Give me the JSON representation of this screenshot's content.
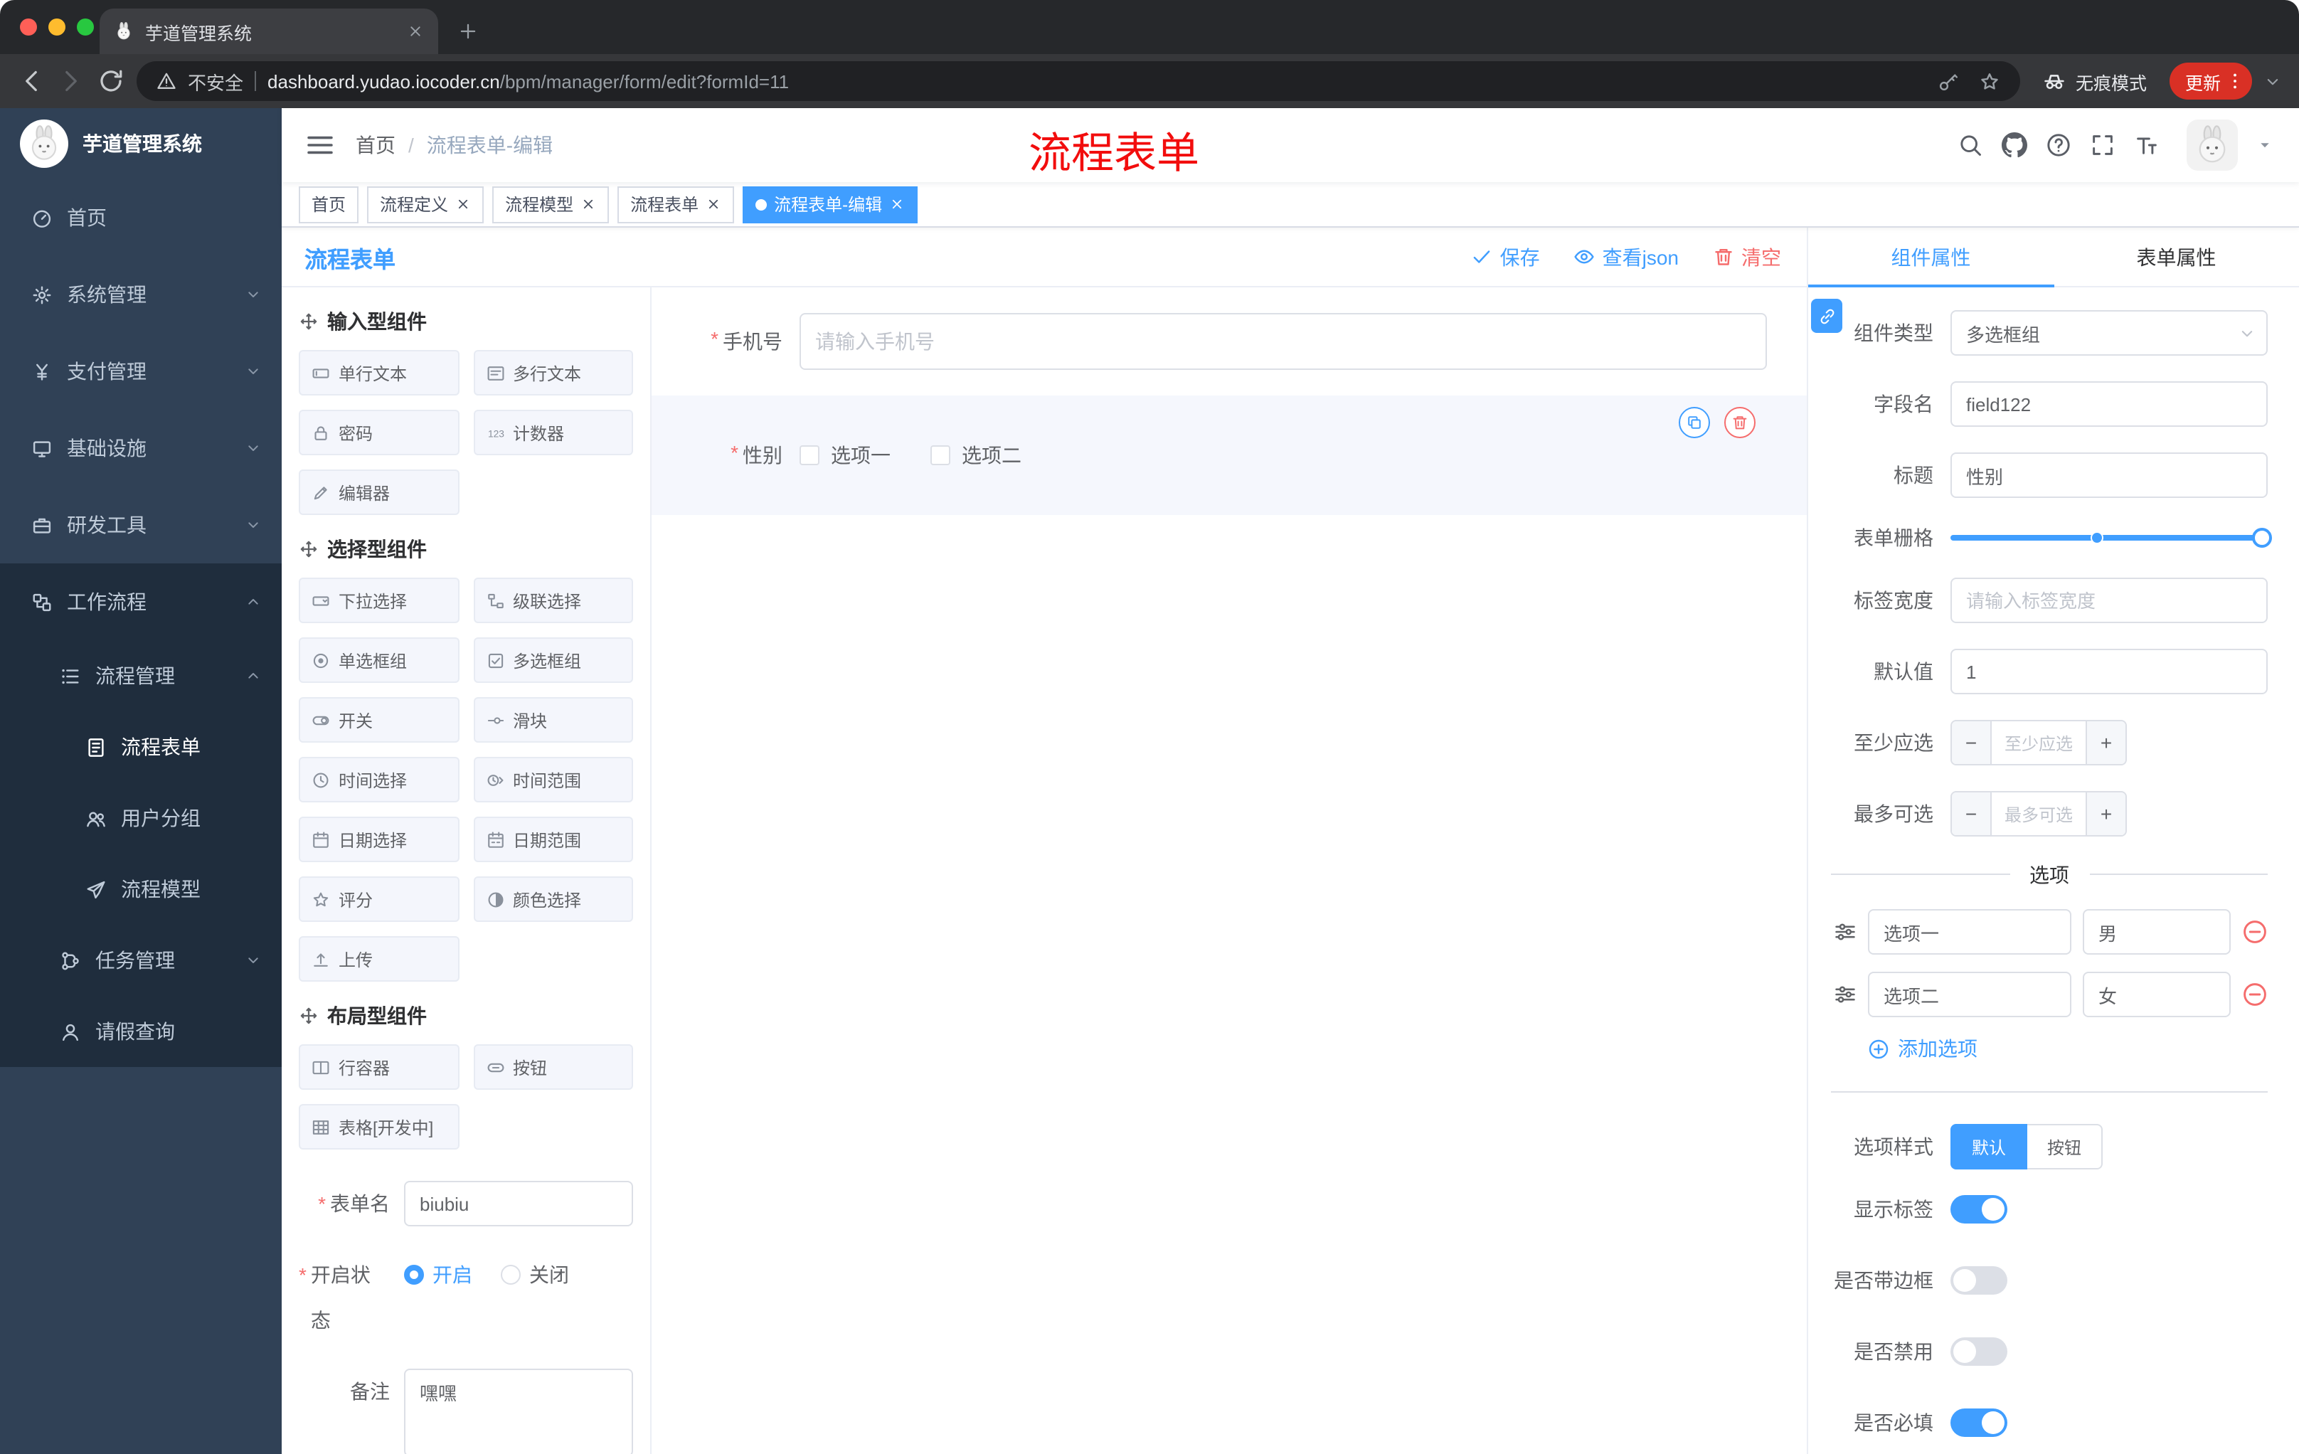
{
  "colors": {
    "primary": "#409eff",
    "danger": "#f56c6c",
    "annotation": "#f20d0d",
    "sidebar_bg": "#304156",
    "sidebar_submenu_bg": "#1f2d3d",
    "update_pill": "#d93025"
  },
  "browser": {
    "tab_title": "芋道管理系统",
    "security_label": "不安全",
    "url_domain": "dashboard.yudao.iocoder.cn",
    "url_path": "/bpm/manager/form/edit?formId=11",
    "incognito_label": "无痕模式",
    "update_label": "更新"
  },
  "sidebar": {
    "logo_title": "芋道管理系统",
    "menu": [
      {
        "name": "home",
        "label": "首页",
        "icon": "dashboard-icon",
        "level": 1
      },
      {
        "name": "system-manage",
        "label": "系统管理",
        "icon": "gear-icon",
        "level": 1,
        "chevron": "down"
      },
      {
        "name": "payment-manage",
        "label": "支付管理",
        "icon": "payment-icon",
        "level": 1,
        "chevron": "down"
      },
      {
        "name": "infrastructure",
        "label": "基础设施",
        "icon": "infrastructure-icon",
        "level": 1,
        "chevron": "down"
      },
      {
        "name": "dev-tools",
        "label": "研发工具",
        "icon": "devtools-icon",
        "level": 1,
        "chevron": "down"
      },
      {
        "name": "workflow",
        "label": "工作流程",
        "icon": "workflow-icon",
        "level": 1,
        "chevron": "up",
        "dark": true
      },
      {
        "name": "process-manage",
        "label": "流程管理",
        "icon": "process-manage-icon",
        "level": 2,
        "chevron": "up",
        "dark": true
      },
      {
        "name": "process-form",
        "label": "流程表单",
        "icon": "form-icon",
        "level": 3,
        "dark": true,
        "active": true
      },
      {
        "name": "user-group",
        "label": "用户分组",
        "icon": "user-group-icon",
        "level": 3,
        "dark": true
      },
      {
        "name": "process-model",
        "label": "流程模型",
        "icon": "model-icon",
        "level": 3,
        "dark": true
      },
      {
        "name": "task-manage",
        "label": "任务管理",
        "icon": "task-icon",
        "level": 2,
        "chevron": "down",
        "dark": true
      },
      {
        "name": "leave-query",
        "label": "请假查询",
        "icon": "leave-icon",
        "level": 2,
        "dark": true
      }
    ]
  },
  "header": {
    "breadcrumb": [
      "首页",
      "流程表单-编辑"
    ],
    "annotation": "流程表单"
  },
  "tags": [
    {
      "name": "home",
      "label": "首页"
    },
    {
      "name": "process-definition",
      "label": "流程定义",
      "closable": true
    },
    {
      "name": "process-model",
      "label": "流程模型",
      "closable": true
    },
    {
      "name": "process-form",
      "label": "流程表单",
      "closable": true
    },
    {
      "name": "process-form-edit",
      "label": "流程表单-编辑",
      "closable": true,
      "active": true
    }
  ],
  "designer": {
    "title": "流程表单",
    "actions": [
      {
        "label": "保存",
        "icon": "check-icon",
        "type": "primary"
      },
      {
        "label": "查看json",
        "icon": "eye-icon",
        "type": "primary"
      },
      {
        "label": "清空",
        "icon": "trash-icon",
        "type": "danger"
      }
    ],
    "palette_groups": [
      {
        "title": "输入型组件",
        "items": [
          {
            "name": "single-line-text",
            "label": "单行文本",
            "icon": "single-line-icon"
          },
          {
            "name": "multi-line-text",
            "label": "多行文本",
            "icon": "multi-line-icon"
          },
          {
            "name": "password",
            "label": "密码",
            "icon": "password-icon"
          },
          {
            "name": "counter",
            "label": "计数器",
            "icon": "counter-icon"
          },
          {
            "name": "editor",
            "label": "编辑器",
            "icon": "editor-icon"
          }
        ]
      },
      {
        "title": "选择型组件",
        "items": [
          {
            "name": "select",
            "label": "下拉选择",
            "icon": "select-icon"
          },
          {
            "name": "cascader",
            "label": "级联选择",
            "icon": "cascader-icon"
          },
          {
            "name": "radio-group",
            "label": "单选框组",
            "icon": "radio-icon"
          },
          {
            "name": "checkbox-group",
            "label": "多选框组",
            "icon": "checkbox-icon"
          },
          {
            "name": "switch",
            "label": "开关",
            "icon": "switch-icon"
          },
          {
            "name": "slider",
            "label": "滑块",
            "icon": "slider-icon"
          },
          {
            "name": "time-picker",
            "label": "时间选择",
            "icon": "time-icon"
          },
          {
            "name": "time-range",
            "label": "时间范围",
            "icon": "time-range-icon"
          },
          {
            "name": "date-picker",
            "label": "日期选择",
            "icon": "date-icon"
          },
          {
            "name": "date-range",
            "label": "日期范围",
            "icon": "date-range-icon"
          },
          {
            "name": "rate",
            "label": "评分",
            "icon": "rate-icon"
          },
          {
            "name": "color-picker",
            "label": "颜色选择",
            "icon": "color-icon"
          },
          {
            "name": "upload",
            "label": "上传",
            "icon": "upload-icon"
          }
        ]
      },
      {
        "title": "布局型组件",
        "items": [
          {
            "name": "row-container",
            "label": "行容器",
            "icon": "row-icon"
          },
          {
            "name": "button",
            "label": "按钮",
            "icon": "button-icon"
          },
          {
            "name": "table",
            "label": "表格[开发中]",
            "icon": "table-icon"
          }
        ]
      }
    ],
    "meta": {
      "form_name_label": "表单名",
      "form_name_value": "biubiu",
      "status_label": "开启状态",
      "status_on": "开启",
      "status_off": "关闭",
      "remark_label": "备注",
      "remark_value": "嘿嘿"
    },
    "canvas": {
      "phone": {
        "label": "手机号",
        "placeholder": "请输入手机号"
      },
      "gender": {
        "label": "性别",
        "options": [
          "选项一",
          "选项二"
        ]
      }
    }
  },
  "properties": {
    "tabs": [
      "组件属性",
      "表单属性"
    ],
    "active_tab": "组件属性",
    "component_type": {
      "label": "组件类型",
      "value": "多选框组"
    },
    "field_name": {
      "label": "字段名",
      "value": "field122"
    },
    "title": {
      "label": "标题",
      "value": "性别"
    },
    "grid": {
      "label": "表单栅格"
    },
    "label_width": {
      "label": "标签宽度",
      "placeholder": "请输入标签宽度"
    },
    "default_value": {
      "label": "默认值",
      "value": "1"
    },
    "min_select": {
      "label": "至少应选",
      "placeholder": "至少应选"
    },
    "max_select": {
      "label": "最多可选",
      "placeholder": "最多可选"
    },
    "options_title": "选项",
    "options": [
      {
        "label": "选项一",
        "value": "男"
      },
      {
        "label": "选项二",
        "value": "女"
      }
    ],
    "add_option_label": "添加选项",
    "option_style": {
      "label": "选项样式",
      "options": [
        "默认",
        "按钮"
      ],
      "selected": "默认"
    },
    "switches": [
      {
        "name": "show-label-switch",
        "label": "显示标签",
        "on": true
      },
      {
        "name": "border-switch",
        "label": "是否带边框",
        "on": false
      },
      {
        "name": "disabled-switch",
        "label": "是否禁用",
        "on": false
      },
      {
        "name": "required-switch",
        "label": "是否必填",
        "on": true
      }
    ]
  }
}
